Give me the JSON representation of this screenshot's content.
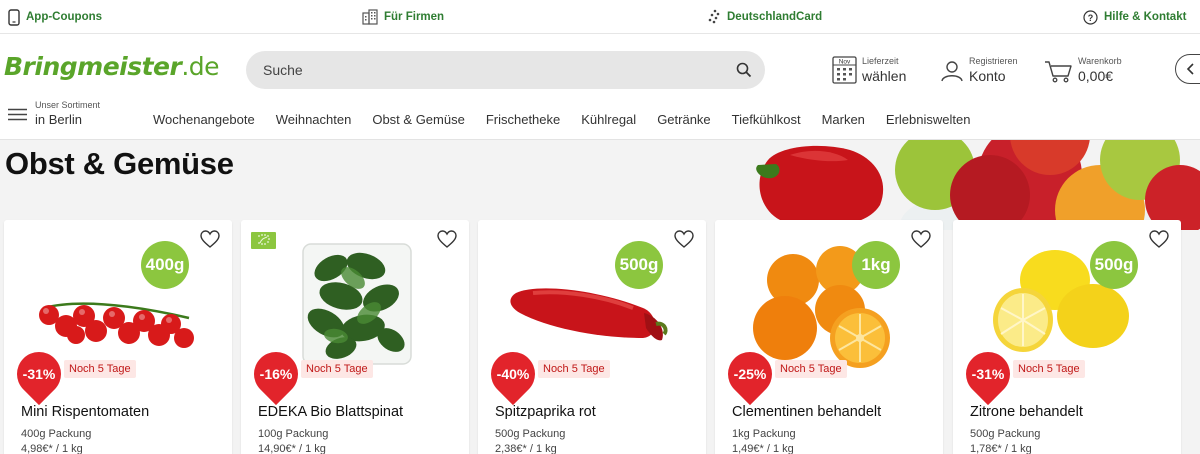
{
  "topbar": {
    "app_coupons": "App-Coupons",
    "firmen": "Für Firmen",
    "deutschland_card": "DeutschlandCard",
    "help": "Hilfe & Kontakt"
  },
  "header": {
    "logo_main": "Bringmeister",
    "logo_tld": ".de",
    "search_placeholder": "Suche",
    "delivery": {
      "calendar_month": "Nov",
      "small": "Lieferzeit",
      "big": "wählen"
    },
    "account": {
      "small": "Registrieren",
      "big": "Konto"
    },
    "cart": {
      "small": "Warenkorb",
      "big": "0,00€"
    }
  },
  "sortiment": {
    "line1": "Unser Sortiment",
    "line2": "in Berlin"
  },
  "nav": [
    "Wochenangebote",
    "Weihnachten",
    "Obst & Gemüse",
    "Frischetheke",
    "Kühlregal",
    "Getränke",
    "Tiefkühlkost",
    "Marken",
    "Erlebniswelten"
  ],
  "page_title": "Obst & Gemüse",
  "colors": {
    "brand_green": "#5aa52a",
    "badge_green": "#8cc63f",
    "discount_red": "#e2242b"
  },
  "products": [
    {
      "name": "Mini Rispentomaten",
      "weight": "400g",
      "discount": "-31%",
      "days": "Noch 5 Tage",
      "pack": "400g Packung",
      "price": "4,98€* / 1 kg",
      "image": "tomatoes"
    },
    {
      "name": "EDEKA Bio Blattspinat",
      "weight": "",
      "discount": "-16%",
      "days": "Noch 5 Tage",
      "pack": "100g Packung",
      "price": "14,90€* / 1 kg",
      "image": "spinach",
      "bio": true
    },
    {
      "name": "Spitzpaprika rot",
      "weight": "500g",
      "discount": "-40%",
      "days": "Noch 5 Tage",
      "pack": "500g Packung",
      "price": "2,38€* / 1 kg",
      "image": "pepper"
    },
    {
      "name": "Clementinen behandelt",
      "weight": "1kg",
      "discount": "-25%",
      "days": "Noch 5 Tage",
      "pack": "1kg Packung",
      "price": "1,49€* / 1 kg",
      "image": "clementines"
    },
    {
      "name": "Zitrone behandelt",
      "weight": "500g",
      "discount": "-31%",
      "days": "Noch 5 Tage",
      "pack": "500g Packung",
      "price": "1,78€* / 1 kg",
      "image": "lemons"
    }
  ]
}
